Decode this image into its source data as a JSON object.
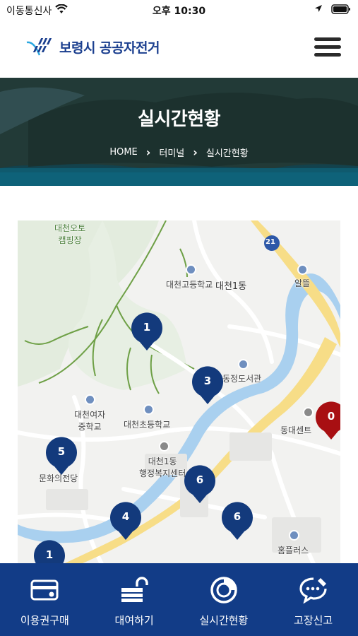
{
  "status_bar": {
    "carrier": "이동통신사",
    "time": "오후 10:30"
  },
  "header": {
    "logo_text": "보령시 공공자전거"
  },
  "hero": {
    "title": "실시간현황",
    "breadcrumb": [
      "HOME",
      "터미널",
      "실시간현황"
    ]
  },
  "map": {
    "labels": {
      "campground": "대천오토\n캠핑장",
      "route_shield": "21",
      "highschool": "대천고등학교",
      "dong": "대천1동",
      "gas": "알뜰",
      "library": "동정도서관",
      "girls_ms": "대천여자\n중학교",
      "elementary": "대천초등학교",
      "dongdae": "동대센트",
      "community": "대천1동\n행정복지센터",
      "culture": "문화의전당",
      "homeplus": "홈플러스"
    },
    "markers": [
      {
        "id": "m1",
        "count": "1",
        "color": "#133a7c"
      },
      {
        "id": "m3",
        "count": "3",
        "color": "#133a7c"
      },
      {
        "id": "m0",
        "count": "0",
        "color": "#a80f12"
      },
      {
        "id": "m5",
        "count": "5",
        "color": "#133a7c"
      },
      {
        "id": "m6a",
        "count": "6",
        "color": "#133a7c"
      },
      {
        "id": "m4",
        "count": "4",
        "color": "#133a7c"
      },
      {
        "id": "m6b",
        "count": "6",
        "color": "#133a7c"
      },
      {
        "id": "m1b",
        "count": "1",
        "color": "#133a7c"
      }
    ]
  },
  "bottom_nav": [
    {
      "label": "이용권구매",
      "icon": "card-icon"
    },
    {
      "label": "대여하기",
      "icon": "unlock-icon"
    },
    {
      "label": "실시간현황",
      "icon": "realtime-icon"
    },
    {
      "label": "고장신고",
      "icon": "report-icon"
    }
  ],
  "colors": {
    "brand_navy": "#123c87",
    "marker_blue": "#133a7c",
    "marker_red": "#a80f12"
  }
}
